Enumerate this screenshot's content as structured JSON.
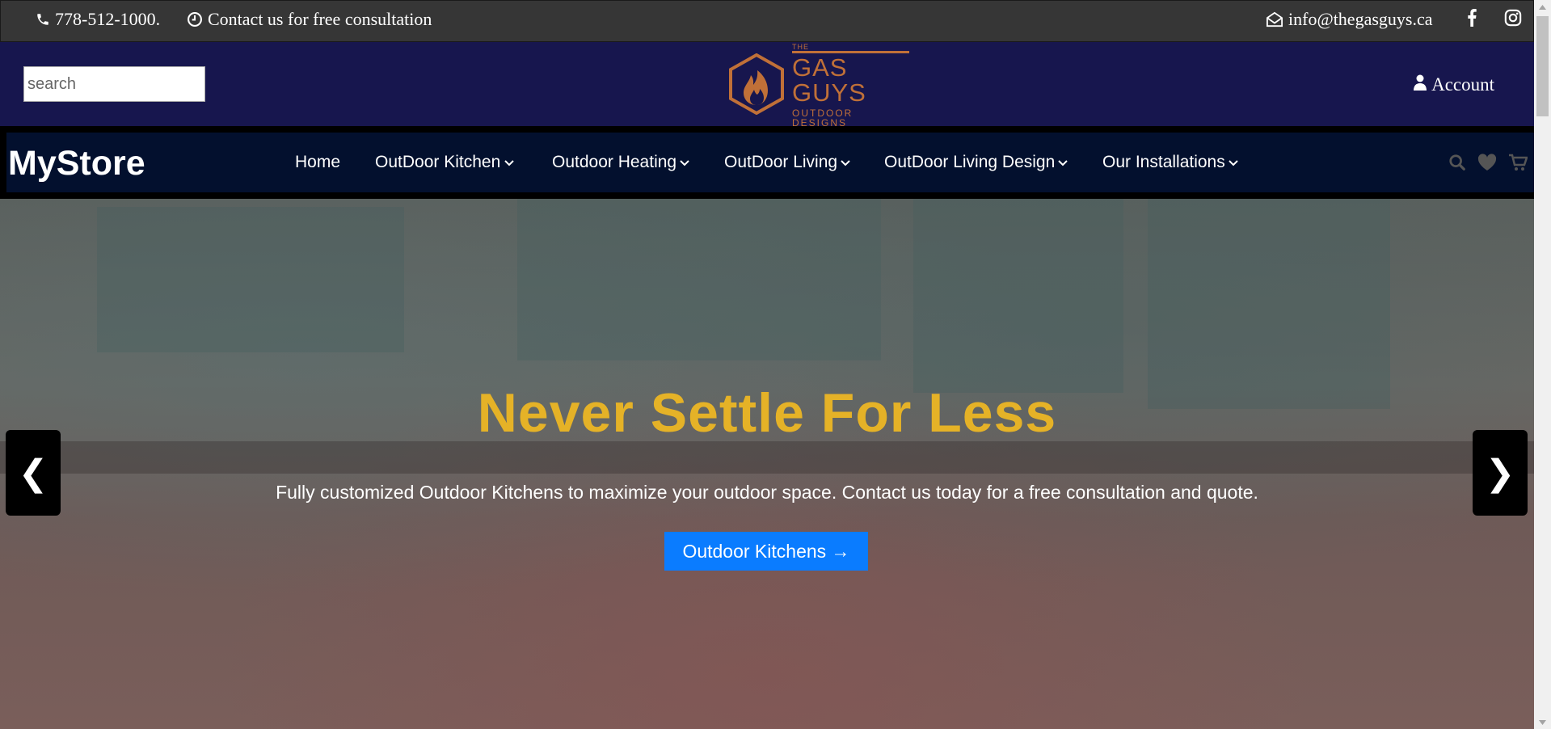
{
  "topbar": {
    "phone": "778-512-1000.",
    "consultation": "Contact us for free consultation",
    "email": "info@thegasguys.ca"
  },
  "header": {
    "search_placeholder": "search",
    "logo": {
      "the": "THE",
      "name": "GAS GUYS",
      "sub": "OUTDOOR DESIGNS"
    },
    "account_label": "Account"
  },
  "nav": {
    "brand": "MyStore",
    "items": [
      {
        "label": "Home"
      },
      {
        "label": "OutDoor Kitchen"
      },
      {
        "label": "Outdoor Heating"
      },
      {
        "label": "OutDoor Living"
      },
      {
        "label": "OutDoor Living Design"
      },
      {
        "label": "Our Installations"
      }
    ]
  },
  "hero": {
    "title": "Never Settle For Less",
    "subtitle": "Fully customized Outdoor Kitchens to maximize your outdoor space. Contact us today for a free consultation and quote.",
    "button_label": "Outdoor Kitchens →",
    "prev_label": "❮",
    "next_label": "❯"
  },
  "colors": {
    "topbar_bg": "#363636",
    "header_bg": "#17164e",
    "nav_bg": "#03102e",
    "hero_title": "#e5b227",
    "button_bg": "#0a7cff",
    "logo_copper": "#c07038"
  }
}
